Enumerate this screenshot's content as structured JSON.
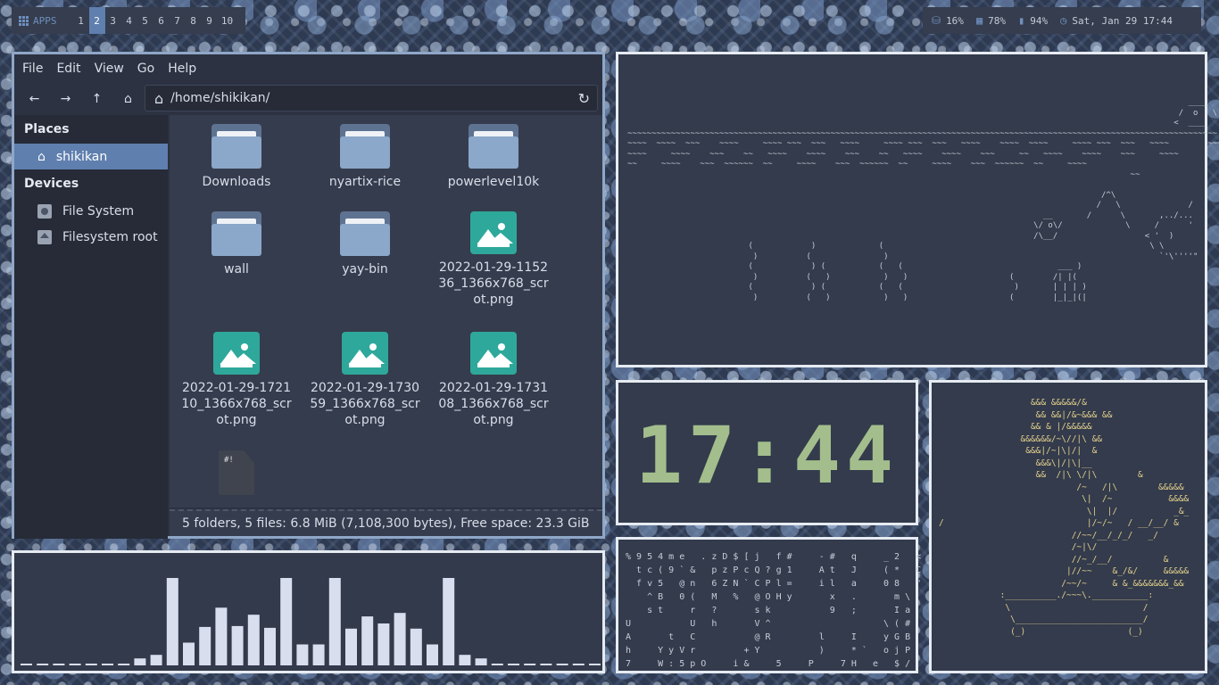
{
  "topbar": {
    "apps_label": "APPS",
    "workspaces": [
      "1",
      "2",
      "3",
      "4",
      "5",
      "6",
      "7",
      "8",
      "9",
      "10"
    ],
    "active_workspace": "2",
    "disk": "16%",
    "memory": "78%",
    "battery": "94%",
    "datetime": "Sat, Jan 29 17:44"
  },
  "file_manager": {
    "menu": [
      "File",
      "Edit",
      "View",
      "Go",
      "Help"
    ],
    "path": "/home/shikikan/",
    "places_header": "Places",
    "places": [
      {
        "label": "shikikan",
        "icon": "home-icon",
        "selected": true
      }
    ],
    "devices_header": "Devices",
    "devices": [
      {
        "label": "File System",
        "icon": "drive-icon"
      },
      {
        "label": "Filesystem root",
        "icon": "eject-icon"
      }
    ],
    "files": [
      {
        "name": "Downloads",
        "type": "folder"
      },
      {
        "name": "nyartix-rice",
        "type": "folder"
      },
      {
        "name": "powerlevel10k",
        "type": "folder"
      },
      {
        "name": "wall",
        "type": "folder"
      },
      {
        "name": "yay-bin",
        "type": "folder"
      },
      {
        "name": "2022-01-29-115236_1366x768_scrot.png",
        "type": "image"
      },
      {
        "name": "2022-01-29-172110_1366x768_scrot.png",
        "type": "image"
      },
      {
        "name": "2022-01-29-173059_1366x768_scrot.png",
        "type": "image"
      },
      {
        "name": "2022-01-29-173108_1366x768_scrot.png",
        "type": "image"
      },
      {
        "name": "",
        "type": "script",
        "badge": "#!"
      }
    ],
    "status": "5 folders, 5 files: 6.8 MiB (7,108,300 bytes), Free space: 23.3 GiB"
  },
  "visualizer": {
    "levels": [
      0.02,
      0.02,
      0.02,
      0.02,
      0.02,
      0.02,
      0.02,
      0.08,
      0.12,
      1.0,
      0.26,
      0.44,
      0.66,
      0.45,
      0.58,
      0.43,
      1.0,
      0.24,
      0.24,
      1.0,
      0.42,
      0.56,
      0.48,
      0.6,
      0.42,
      0.24,
      1.0,
      0.12,
      0.08,
      0.02,
      0.02,
      0.02,
      0.02,
      0.02,
      0.02,
      0.02
    ],
    "color": "#d8deee"
  },
  "clock": {
    "time": "17:44",
    "color": "#a3be8c"
  },
  "aquarium_art": "                                                                                                                    ____\n                                                                                                                  /  o   \\\n                                                                                                                 <  ____\n~~~~~~~~~~~~~~~~~~~~~~~~~~~~~~~~~~~~~~~~~~~~~~~~~~~~~~~~~~~~~~~~~~~~~~~~~~~~~~~~~~~~~~~~~~~~~~~~~~~~~~~~~~~~~~~~~~~~~~~~~~|\n~~~~  ~~~~  ~~~    ~~~~     ~~~~ ~~~  ~~~   ~~~~     ~~~~ ~~~  ~~~   ~~~~    ~~~~  ~~~~     ~~~~ ~~~  ~~~   ~~~~        ~~~~|\n~~~~     ~~~~    ~~~    ~~   ~~~~    ~~~~    ~~~    ~~   ~~~~    ~~~~    ~~~     ~~   ~~~~    ~~~~    ~~~     ~~~~\n~~     ~~~~    ~~~  ~~~~~~  ~~     ~~~~    ~~~  ~~~~~~  ~~     ~~~~    ~~~  ~~~~~~  ~~     ~~~~\n                                                                                                        ~~\n\n                                                                                                  /^\\\n                                                                                                 /   \\              /\n                                                                                      __       /      \\       ,../...\n                                                                                    \\/ o\\/             \\     /      '\n                                                                                    /\\__/                  < '  )\n                         (            )             (                                                       \\ \\\n                          )          (               )                                                        `'\\''''\"\n                         (            ) (           (   (                                ___ )\n                          )          (   )           )   )                     (        /| |(\n                         (            ) (           (   (                       )       | | | )\n                          )          (   )           )   )                     (        |_|_|(|",
  "matrix_art": "% 9 5 4 m e   . z D $ [ j   f #     - #   q     _ 2   <\n  t c ( 9 ` &   p z P c Q ? g 1     A t   J     ( *   C\n  f v 5   @ n   6 Z N ` C P l =     i l   a     0 8   \"\n    ^ B   0 (   M   %   @ O H y       x   .       m \\\n    s t     r   ?       s k           9   ;       I a\nU           U   h       V ^                     \\ ( #\nA       t   C           @ R         l     I     y G B\nh     Y y V r         + Y           )     * `   o j P\n7     W : 5 p O     i &     5     P     7 H   e   $ /",
  "tree_art": "                  &&& &&&&&/&\n                   && &&|/&~&&& &&\n                  && & |/&&&&&\n                &&&&&&/~\\//|\\ &&\n                 &&&|/~|\\|/|  &\n                   &&&\\|/|\\|__\n                   &&  /|\\ \\/|\\        &\n                           /~   /|\\        &&&&&\n                            \\|  /~           &&&&\n                             \\|  |/           _&_\n/                            |/~/~   / __/__/ &\n                          //~~/__/_/_/   _/\n                          /~|\\/\n                          //~_/__/          &\n                         |//~~    &_/&/     &&&&&\n                        /~~/~     & &_&&&&&&&_&&\n            :__________./~~~\\.___________:\n             \\                          /\n              \\_________________________/\n              (_)                    (_)"
}
